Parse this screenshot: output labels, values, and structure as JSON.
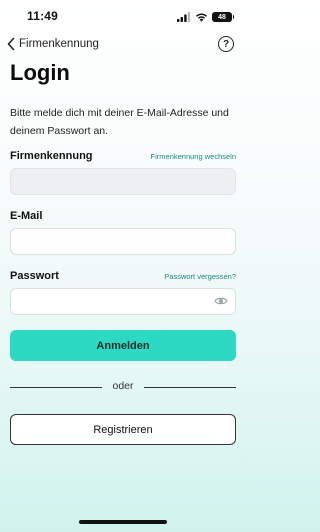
{
  "status_bar": {
    "time": "11:49",
    "battery_level": "48"
  },
  "nav": {
    "back_label": "Firmenkennung",
    "help_symbol": "?"
  },
  "title": "Login",
  "intro_text": "Bitte melde dich mit deiner E-Mail-Adresse und deinem Passwort an.",
  "fields": {
    "company": {
      "label": "Firmenkennung",
      "link": "Firmenkennung wechseln",
      "value": "",
      "disabled": true
    },
    "email": {
      "label": "E-Mail",
      "value": ""
    },
    "password": {
      "label": "Passwort",
      "link": "Passwort vergessen?",
      "value": ""
    }
  },
  "buttons": {
    "login": "Anmelden",
    "divider": "oder",
    "register": "Registrieren"
  },
  "colors": {
    "accent": "#2ed9c3",
    "link": "#1a8a80"
  },
  "icons": [
    "signal-icon",
    "wifi-icon",
    "battery-icon",
    "chevron-left-icon",
    "help-icon",
    "eye-icon"
  ]
}
